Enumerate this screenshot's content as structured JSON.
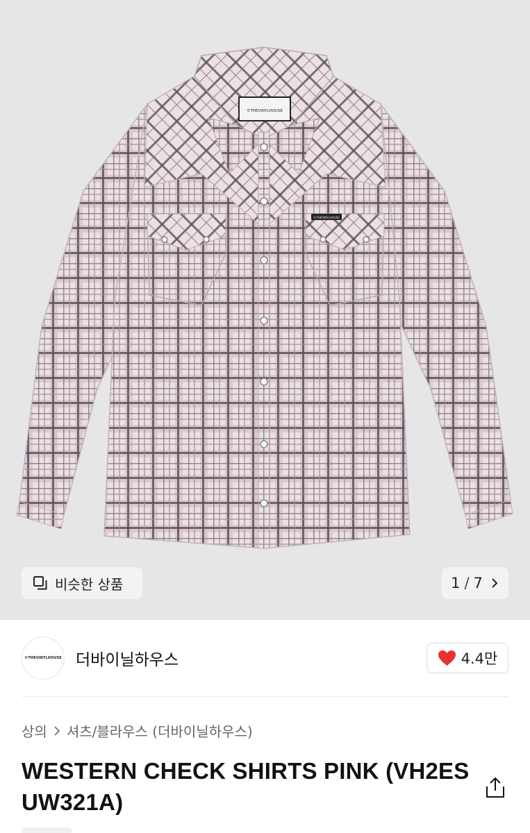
{
  "product": {
    "title": "WESTERN CHECK SHIRTS PINK (VH2ES UW321A)",
    "image_alt": "WESTERN CHECK SHIRTS PINK"
  },
  "gallery": {
    "similar_label": "비슷한 상품",
    "similar_icon": "copy-squares-icon",
    "page_current": "1",
    "page_separator": "/",
    "page_total": "7",
    "next_icon": "chevron-right-icon"
  },
  "brand": {
    "logo_text": "©THEVINYLHOUSE",
    "name": "더바이닐하우스",
    "like_count": "4.4만",
    "like_icon": "heart-icon",
    "like_color": "#e8322f"
  },
  "breadcrumb": {
    "level1": "상의",
    "level2": "셔츠/블라우스 (더바이닐하우스)"
  },
  "shirt_labels": {
    "neck_tag": "©THEVINYLHOUSE",
    "pocket_tag": "©THEVINYLHOUSE"
  },
  "actions": {
    "share_icon": "share-icon"
  }
}
